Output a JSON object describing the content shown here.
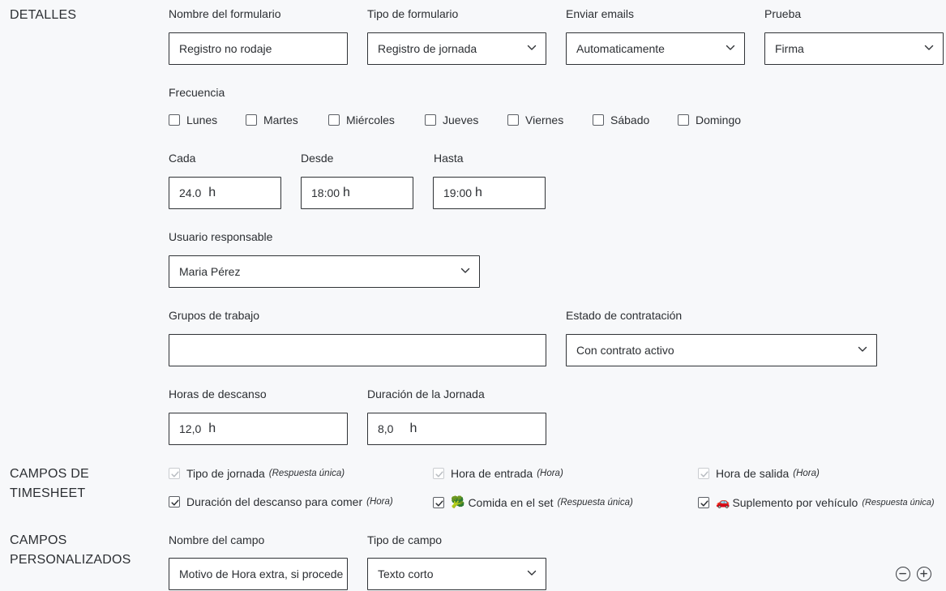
{
  "details": {
    "title": "DETALLES",
    "form_name": {
      "label": "Nombre del formulario",
      "value": "Registro no rodaje"
    },
    "form_type": {
      "label": "Tipo de formulario",
      "value": "Registro de jornada"
    },
    "send_emails": {
      "label": "Enviar emails",
      "value": "Automaticamente"
    },
    "proof": {
      "label": "Prueba",
      "value": "Firma"
    },
    "frequency": {
      "label": "Frecuencia",
      "days": [
        "Lunes",
        "Martes",
        "Miércoles",
        "Jueves",
        "Viernes",
        "Sábado",
        "Domingo"
      ]
    },
    "every": {
      "label": "Cada",
      "value": "24.0",
      "unit": "h"
    },
    "from": {
      "label": "Desde",
      "value": "18:00",
      "unit": "h"
    },
    "to": {
      "label": "Hasta",
      "value": "19:00",
      "unit": "h"
    },
    "responsible_user": {
      "label": "Usuario responsable",
      "value": "Maria Pérez"
    },
    "work_groups": {
      "label": "Grupos de trabajo",
      "value": ""
    },
    "contract_status": {
      "label": "Estado de contratación",
      "value": "Con contrato activo"
    },
    "rest_hours": {
      "label": "Horas de descanso",
      "value": "12,0",
      "unit": "h"
    },
    "day_duration": {
      "label": "Duración de la Jornada",
      "value": "8,0",
      "unit": "h"
    }
  },
  "timesheet": {
    "title_line1": "CAMPOS DE",
    "title_line2": "TIMESHEET",
    "fields": [
      {
        "label": "Tipo de jornada",
        "hint": "(Respuesta única)",
        "emoji": ""
      },
      {
        "label": "Hora de entrada",
        "hint": "(Hora)",
        "emoji": ""
      },
      {
        "label": "Hora de salida",
        "hint": "(Hora)",
        "emoji": ""
      },
      {
        "label": "Duración del descanso para comer",
        "hint": "(Hora)",
        "emoji": ""
      },
      {
        "label": "Comida en el set",
        "hint": "(Respuesta única)",
        "emoji": "🥦"
      },
      {
        "label": "Suplemento por vehículo",
        "hint": "(Respuesta única)",
        "emoji": "🚗"
      }
    ]
  },
  "custom": {
    "title_line1": "CAMPOS",
    "title_line2": "PERSONALIZADOS",
    "field_name": {
      "label": "Nombre del campo",
      "value": "Motivo de Hora extra, si procede"
    },
    "field_type": {
      "label": "Tipo de campo",
      "value": "Texto corto"
    }
  }
}
